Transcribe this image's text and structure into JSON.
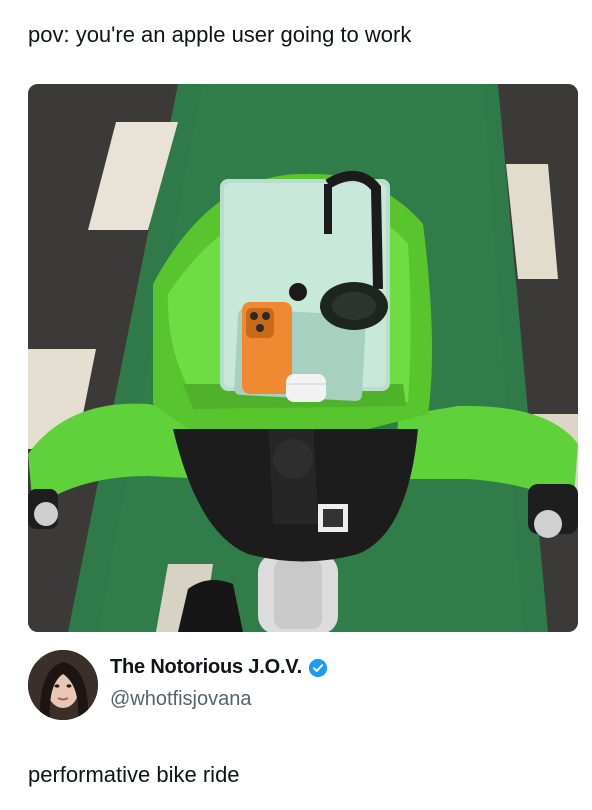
{
  "post": {
    "caption": "pov: you're an apple user going to work"
  },
  "media": {
    "kind": "photo",
    "icon": "photo-image"
  },
  "quoted_tweet": {
    "display_name": "The Notorious J.O.V.",
    "handle": "@whotfisjovana",
    "verified": true,
    "verified_color": "#1d9bf0",
    "text": "performative bike ride"
  },
  "colors": {
    "bike_green": "#5fd13a",
    "lane_green": "#2f7d4a"
  }
}
